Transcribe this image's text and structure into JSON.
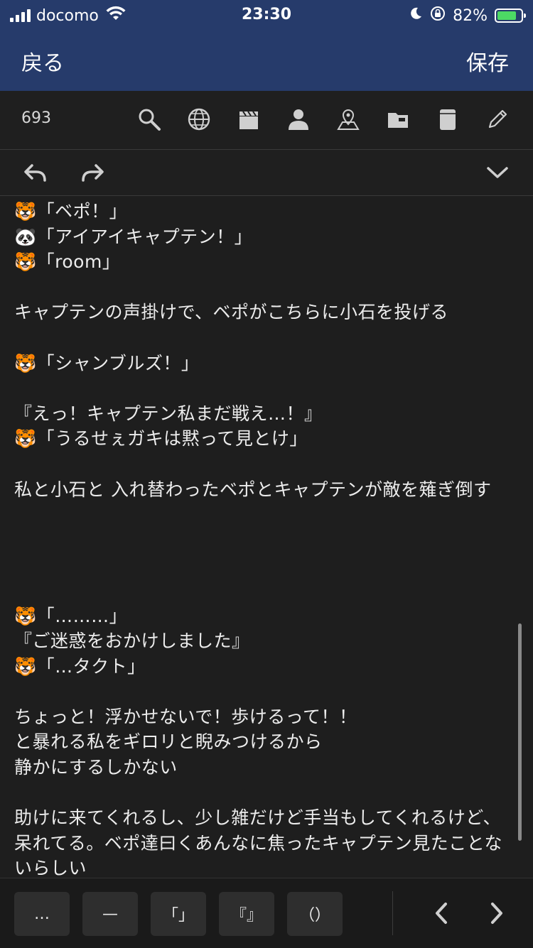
{
  "status_bar": {
    "carrier": "docomo",
    "time": "23:30",
    "battery": "82%",
    "battery_level": 0.82,
    "icons": [
      "signal-icon",
      "wifi-icon",
      "moon-icon",
      "rotation-lock-icon",
      "battery-charging-icon"
    ]
  },
  "nav": {
    "back_label": "戻る",
    "save_label": "保存"
  },
  "toolbar": {
    "char_count": "693",
    "icons": [
      "search-icon",
      "globe-icon",
      "clapperboard-icon",
      "person-icon",
      "map-pin-icon",
      "folder-icon",
      "document-icon",
      "pencil-icon"
    ]
  },
  "editor": {
    "text": "🐯「ベポ！」\n🐼「アイアイキャプテン！」\n🐯「room」\n\nキャプテンの声掛けで、ベポがこちらに小石を投げる\n\n🐯「シャンブルズ！」\n\n『えっ！キャプテン私まだ戦え…！』\n🐯「うるせぇガキは黙って見とけ」\n\n私と小石と 入れ替わったベポとキャプテンが敵を薙ぎ倒す\n\n\n\n\n🐯「………」\n『ご迷惑をおかけしました』\n🐯「…タクト」\n\nちょっと！浮かせないで！歩けるって！！\nと暴れる私をギロリと睨みつけるから\n静かにするしかない\n\n助けに来てくれるし、少し雑だけど手当もしてくれるけど、呆れてる。ベポ達曰くあんなに焦ったキャプテン見たことないらしい"
  },
  "accessory_bar": {
    "keys": [
      "…",
      "—",
      "「」",
      "『』",
      "（）"
    ]
  },
  "colors": {
    "nav_bg": "#263b6b",
    "editor_bg": "#1e1e1e",
    "key_bg": "#2e2e2e",
    "battery_fill": "#4cd964"
  }
}
